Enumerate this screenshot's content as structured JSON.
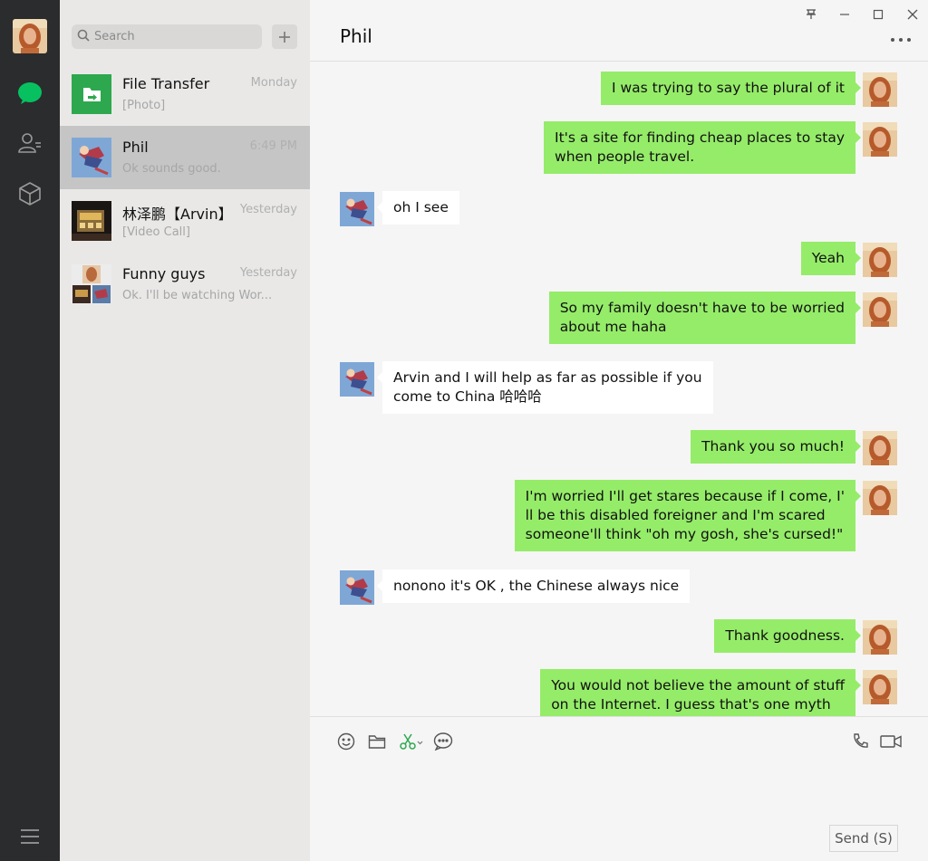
{
  "app": {
    "accent_green": "#07c160",
    "bubble_me_color": "#95ec69",
    "bubble_them_color": "#ffffff"
  },
  "rail": {
    "icons": [
      "chat-icon",
      "contacts-icon",
      "favorites-cube-icon"
    ],
    "menu_icon": "menu-icon"
  },
  "search": {
    "placeholder": "Search"
  },
  "conversations": [
    {
      "name": "File Transfer",
      "time": "Monday",
      "preview": "[Photo]",
      "icon": "file-transfer-icon"
    },
    {
      "name": "Phil",
      "time": "6:49 PM",
      "preview": "Ok sounds good.",
      "active": true
    },
    {
      "name": "林泽鹏【Arvin】",
      "time": "Yesterday",
      "preview": "[Video Call]"
    },
    {
      "name": "Funny guys",
      "time": "Yesterday",
      "preview": "Ok. I'll be watching Wor..."
    }
  ],
  "chat": {
    "title": "Phil",
    "messages": [
      {
        "from": "me",
        "lines": [
          "I was trying to say the plural of it"
        ]
      },
      {
        "from": "me",
        "lines": [
          "It's a site for finding cheap places to stay",
          "when people travel."
        ]
      },
      {
        "from": "them",
        "lines": [
          "oh  I see"
        ]
      },
      {
        "from": "me",
        "lines": [
          "Yeah"
        ]
      },
      {
        "from": "me",
        "lines": [
          "So my family doesn't have to be worried",
          "about me haha"
        ]
      },
      {
        "from": "them",
        "lines": [
          "Arvin and I will help as far as possible if you",
          "come to China 哈哈哈"
        ]
      },
      {
        "from": "me",
        "lines": [
          "Thank you so much!"
        ]
      },
      {
        "from": "me",
        "lines": [
          "I'm worried I'll get stares because if I come, I'",
          "ll be this disabled foreigner and I'm scared",
          "someone'll think \"oh my gosh, she's cursed!\""
        ]
      },
      {
        "from": "them",
        "lines": [
          "nonono  it's OK , the Chinese always nice"
        ]
      },
      {
        "from": "me",
        "lines": [
          "Thank goodness."
        ]
      },
      {
        "from": "me",
        "lines": [
          "You would not believe the amount of stuff",
          "on the Internet. I guess that's one myth"
        ]
      }
    ]
  },
  "composer": {
    "tools": [
      "emoji-icon",
      "folder-icon",
      "scissors-icon",
      "chat-bubble-icon"
    ],
    "call_icons": [
      "phone-icon",
      "video-icon"
    ],
    "send_label": "Send (S)"
  }
}
